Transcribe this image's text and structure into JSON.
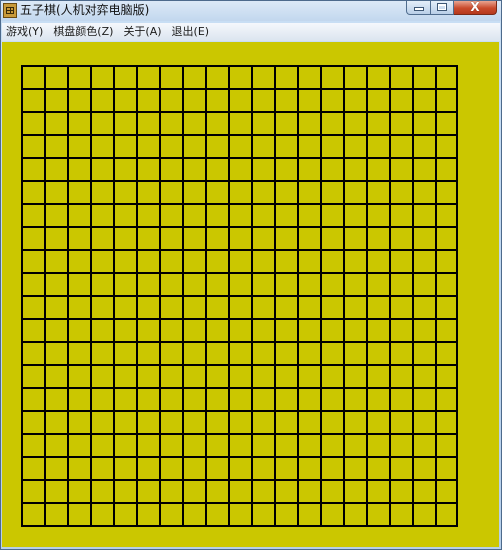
{
  "window": {
    "title": "五子棋(人机对弈电脑版)",
    "icon": "gomoku-app-icon",
    "controls": {
      "minimize_icon": "minimize-icon",
      "maximize_icon": "maximize-icon",
      "close_glyph": "X"
    }
  },
  "menu": {
    "items": [
      {
        "label": "游戏(Y)"
      },
      {
        "label": "棋盘颜色(Z)"
      },
      {
        "label": "关于(A)"
      },
      {
        "label": "退出(E)"
      }
    ]
  },
  "board": {
    "background_color": "#cbc700",
    "line_color": "#000000",
    "grid_cells_columns": 19,
    "grid_cells_rows": 20
  },
  "colors": {
    "titlebar": "#c2d7ee",
    "close_button": "#c94a2c",
    "menubar": "#dbe4ef"
  }
}
